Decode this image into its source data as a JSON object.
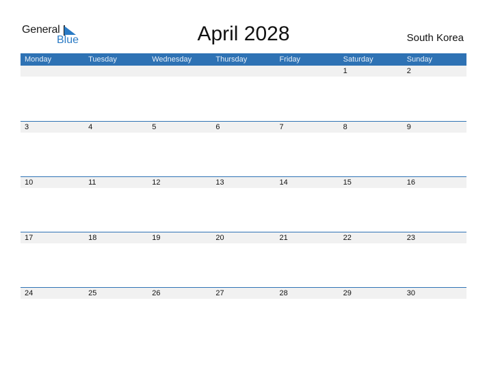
{
  "logo": {
    "word1": "General",
    "word2": "Blue"
  },
  "title": "April 2028",
  "country": "South Korea",
  "weekdays": [
    "Monday",
    "Tuesday",
    "Wednesday",
    "Thursday",
    "Friday",
    "Saturday",
    "Sunday"
  ],
  "weeks": [
    [
      "",
      "",
      "",
      "",
      "",
      "1",
      "2"
    ],
    [
      "3",
      "4",
      "5",
      "6",
      "7",
      "8",
      "9"
    ],
    [
      "10",
      "11",
      "12",
      "13",
      "14",
      "15",
      "16"
    ],
    [
      "17",
      "18",
      "19",
      "20",
      "21",
      "22",
      "23"
    ],
    [
      "24",
      "25",
      "26",
      "27",
      "28",
      "29",
      "30"
    ]
  ],
  "colors": {
    "accent": "#2e72b4",
    "strip": "#f1f1f1",
    "logo_blue": "#2a7ac4"
  }
}
